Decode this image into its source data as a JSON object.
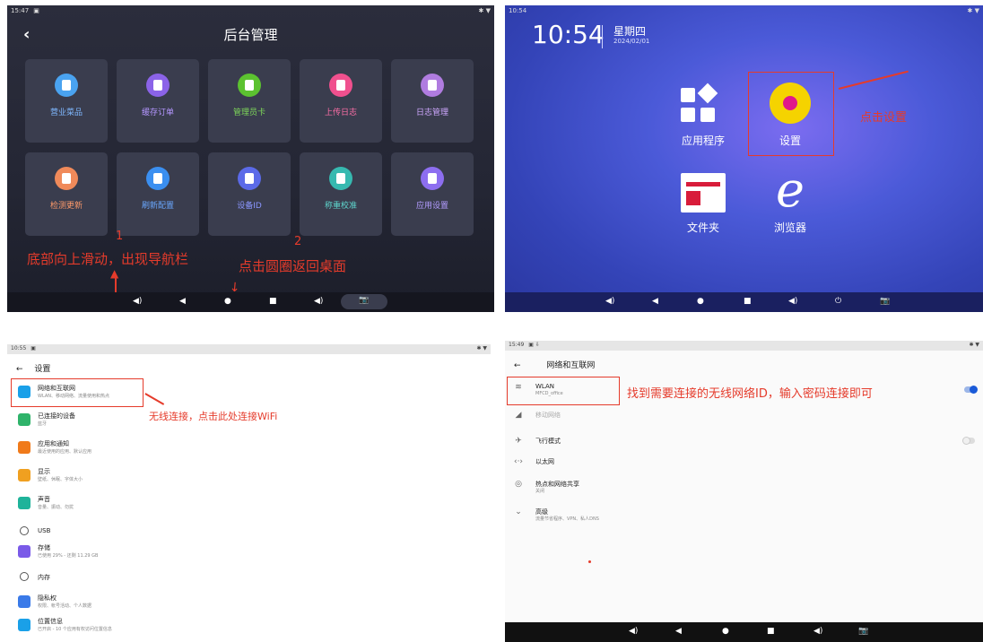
{
  "panel1": {
    "status_time": "15:47",
    "title": "后台管理",
    "tiles": [
      {
        "label": "营业菜品",
        "color": "#4aa3f0",
        "label_color": "#7fb8ff"
      },
      {
        "label": "缓存订单",
        "color": "#8b63e8",
        "label_color": "#b496ff"
      },
      {
        "label": "管理员卡",
        "color": "#5cc230",
        "label_color": "#7fd85a"
      },
      {
        "label": "上传日志",
        "color": "#f0508e",
        "label_color": "#ff6fa8"
      },
      {
        "label": "日志管理",
        "color": "#b07ce0",
        "label_color": "#cfa8ff"
      },
      {
        "label": "检测更新",
        "color": "#f08a5a",
        "label_color": "#ff9a6a"
      },
      {
        "label": "刷新配置",
        "color": "#3b8ff0",
        "label_color": "#6aa8ff"
      },
      {
        "label": "设备ID",
        "color": "#5b6ae8",
        "label_color": "#8a96ff"
      },
      {
        "label": "称重校准",
        "color": "#36b9b0",
        "label_color": "#5fd8cf"
      },
      {
        "label": "应用设置",
        "color": "#8d6ef0",
        "label_color": "#b39cff"
      }
    ],
    "annotation_1_num": "1",
    "annotation_1_text": "底部向上滑动，出现导航栏",
    "annotation_2_num": "2",
    "annotation_2_text": "点击圆圈返回桌面",
    "nav": [
      "◀)",
      "◀",
      "●",
      "■",
      "◀)",
      "📷"
    ]
  },
  "panel2": {
    "status_time": "10:54",
    "clock": "10:54",
    "weekday": "星期四",
    "date": "2024/02/01",
    "apps": [
      {
        "label": "应用程序",
        "color": "#38a820"
      },
      {
        "label": "设置",
        "color": "#e0188a"
      },
      {
        "label": "文件夹",
        "color": "#d81c3a"
      },
      {
        "label": "浏览器",
        "color": "#9a3ad8"
      }
    ],
    "annotation": "点击设置",
    "nav": [
      "◀)",
      "◀",
      "●",
      "■",
      "◀)",
      "⏻",
      "📷"
    ]
  },
  "panel3": {
    "status_time": "10:55",
    "title": "设置",
    "back": "←",
    "items": [
      {
        "title": "网络和互联网",
        "sub": "WLAN、移动网络、流量使用和热点",
        "color": "#1aa0e8"
      },
      {
        "title": "已连接的设备",
        "sub": "蓝牙",
        "color": "#2fb36a"
      },
      {
        "title": "应用和通知",
        "sub": "最近使用的应用、默认应用",
        "color": "#f07a1a"
      },
      {
        "title": "显示",
        "sub": "壁纸、休眠、字体大小",
        "color": "#f0a020"
      },
      {
        "title": "声音",
        "sub": "音量、振动、勿扰",
        "color": "#1fb39a"
      },
      {
        "title": "USB",
        "sub": "",
        "color": ""
      },
      {
        "title": "存储",
        "sub": "已使用 29% - 还剩 11.29 GB",
        "color": "#7a5ae8"
      },
      {
        "title": "内存",
        "sub": "",
        "color": ""
      },
      {
        "title": "隐私权",
        "sub": "权限、帐号活动、个人数据",
        "color": "#3a7ae8"
      },
      {
        "title": "位置信息",
        "sub": "已开启 - 10 个应用有权访问位置信息",
        "color": "#1aa0e8"
      }
    ],
    "annotation": "无线连接，点击此处连接WiFi"
  },
  "panel4": {
    "status_time": "15:49",
    "title": "网络和互联网",
    "back": "←",
    "rows": [
      {
        "icon": "wifi-icon",
        "glyph": "≋",
        "title": "WLAN",
        "sub": "MFCD_office"
      },
      {
        "icon": "signal-icon",
        "glyph": "◢",
        "title": "移动网络",
        "sub": ""
      },
      {
        "icon": "airplane-icon",
        "glyph": "✈",
        "title": "飞行模式",
        "sub": ""
      },
      {
        "icon": "ethernet-icon",
        "glyph": "‹·›",
        "title": "以太网",
        "sub": ""
      },
      {
        "icon": "hotspot-icon",
        "glyph": "◎",
        "title": "热点和网络共享",
        "sub": "关闭"
      },
      {
        "icon": "chevron-down-icon",
        "glyph": "⌄",
        "title": "高级",
        "sub": "流量节省程序、VPN、私人DNS"
      }
    ],
    "annotation": "找到需要连接的无线网络ID，输入密码连接即可",
    "nav": [
      "◀)",
      "◀",
      "●",
      "■",
      "◀)",
      "📷"
    ]
  }
}
